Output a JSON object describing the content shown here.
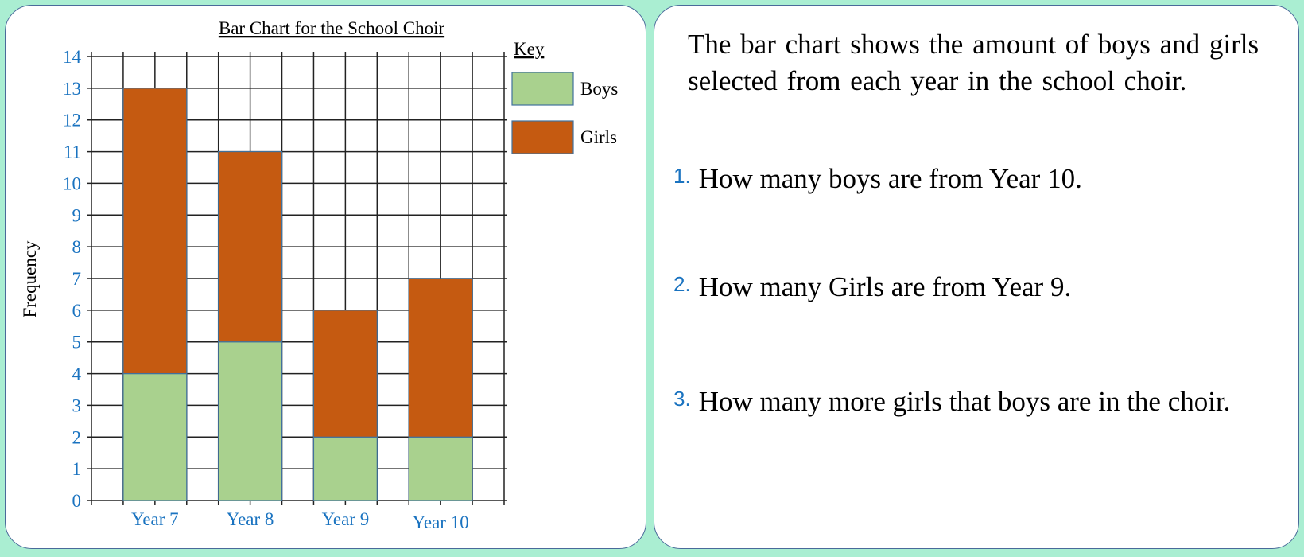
{
  "colors": {
    "background": "#aaeed2",
    "boys": "#a9d18e",
    "girls": "#c55a11",
    "bar_border": "#41719c",
    "axis_text": "#1a73c0",
    "grid": "#222222"
  },
  "chart_data": {
    "type": "bar",
    "stacked": true,
    "title": "Bar Chart for the School Choir",
    "xlabel": "",
    "ylabel": "Frequency",
    "categories": [
      "Year 7",
      "Year 8",
      "Year 9",
      "Year 10"
    ],
    "series": [
      {
        "name": "Boys",
        "values": [
          4,
          5,
          2,
          2
        ]
      },
      {
        "name": "Girls",
        "values": [
          9,
          6,
          4,
          5
        ]
      }
    ],
    "totals": [
      13,
      11,
      6,
      7
    ],
    "ylim": [
      0,
      14
    ],
    "yticks": [
      0,
      1,
      2,
      3,
      4,
      5,
      6,
      7,
      8,
      9,
      10,
      11,
      12,
      13,
      14
    ],
    "grid": true,
    "legend": {
      "title": "Key",
      "placement": "right",
      "entries": [
        "Boys",
        "Girls"
      ]
    }
  },
  "text_panel": {
    "intro": "The bar chart shows the amount of boys and girls selected from each year in the school choir.",
    "questions": [
      {
        "number": "1.",
        "text": "How many boys are from Year 10."
      },
      {
        "number": "2.",
        "text": "How many Girls are from Year 9."
      },
      {
        "number": "3.",
        "text": "How many more girls that boys are in the choir."
      }
    ]
  }
}
